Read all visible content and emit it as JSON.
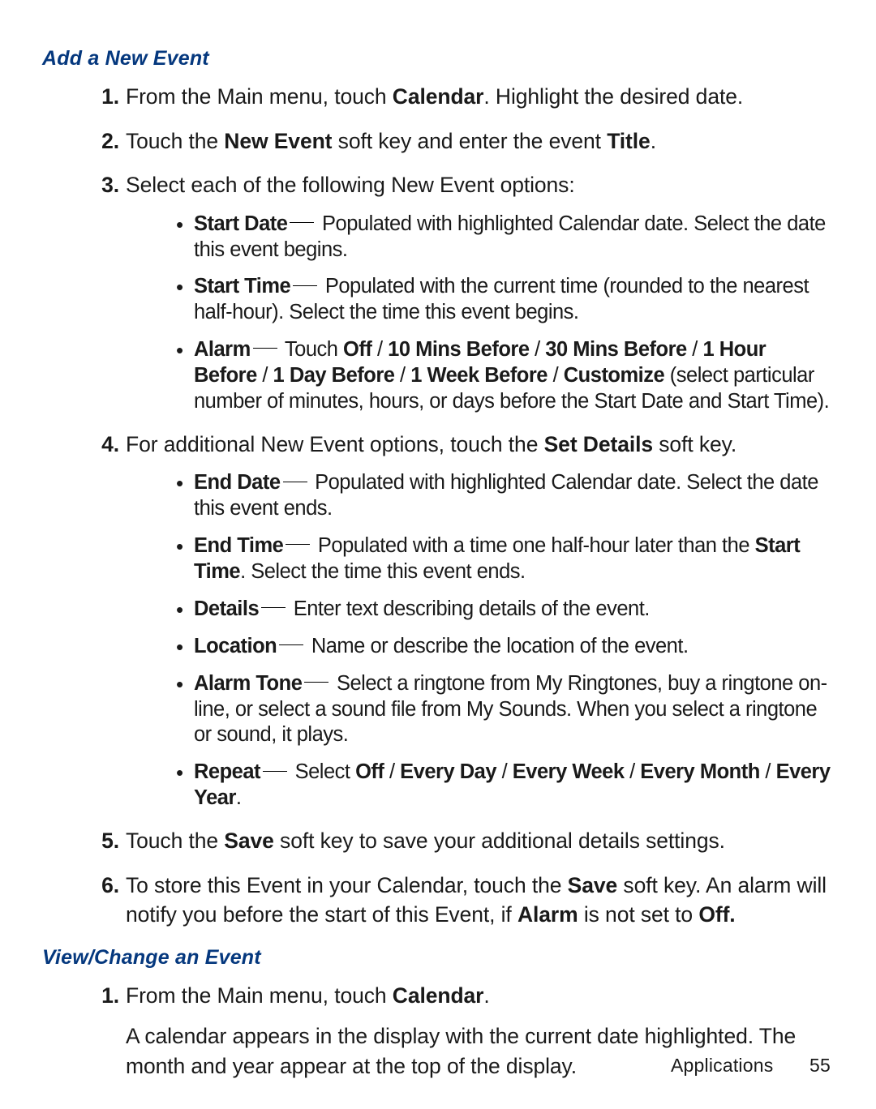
{
  "section1": {
    "title": "Add a New Event",
    "steps": [
      {
        "num": "1.",
        "runs": [
          {
            "t": "From the Main menu, touch "
          },
          {
            "t": "Calendar",
            "b": true
          },
          {
            "t": ". Highlight the desired date."
          }
        ]
      },
      {
        "num": "2.",
        "runs": [
          {
            "t": "Touch the "
          },
          {
            "t": "New Event",
            "b": true
          },
          {
            "t": " soft key and enter the event "
          },
          {
            "t": "Title",
            "b": true
          },
          {
            "t": "."
          }
        ]
      },
      {
        "num": "3.",
        "runs": [
          {
            "t": "Select each of the following New Event options:"
          }
        ],
        "bullets": [
          [
            {
              "t": "Start Date",
              "b": true
            },
            {
              "t": " ",
              "dash": true
            },
            {
              "t": " Populated with highlighted Calendar date. Select the date this event begins."
            }
          ],
          [
            {
              "t": "Start Time",
              "b": true
            },
            {
              "t": " ",
              "dash": true
            },
            {
              "t": " Populated with the current time (rounded to the nearest half-hour). Select the time this event begins."
            }
          ],
          [
            {
              "t": "Alarm",
              "b": true
            },
            {
              "t": " ",
              "dash": true
            },
            {
              "t": " Touch "
            },
            {
              "t": "Off",
              "b": true
            },
            {
              "t": " / "
            },
            {
              "t": "10 Mins Before",
              "b": true
            },
            {
              "t": " / "
            },
            {
              "t": "30 Mins Before",
              "b": true
            },
            {
              "t": " / "
            },
            {
              "t": "1 Hour Before",
              "b": true
            },
            {
              "t": " / "
            },
            {
              "t": "1 Day Before",
              "b": true
            },
            {
              "t": " / "
            },
            {
              "t": "1 Week Before",
              "b": true
            },
            {
              "t": " / "
            },
            {
              "t": "Customize",
              "b": true
            },
            {
              "t": " (select particular number of minutes, hours, or days before the Start Date and Start Time)."
            }
          ]
        ]
      },
      {
        "num": "4.",
        "runs": [
          {
            "t": "For additional New Event options, touch the "
          },
          {
            "t": "Set Details",
            "b": true
          },
          {
            "t": " soft key."
          }
        ],
        "bullets": [
          [
            {
              "t": "End Date",
              "b": true
            },
            {
              "t": " ",
              "dash": true
            },
            {
              "t": " Populated with highlighted Calendar date. Select the date this event ends."
            }
          ],
          [
            {
              "t": "End Time",
              "b": true
            },
            {
              "t": " ",
              "dash": true
            },
            {
              "t": " Populated with a time one half-hour later than the "
            },
            {
              "t": "Start Time",
              "b": true
            },
            {
              "t": ". Select the time this event ends."
            }
          ],
          [
            {
              "t": "Details",
              "b": true
            },
            {
              "t": " ",
              "dash": true
            },
            {
              "t": " Enter text describing details of the event."
            }
          ],
          [
            {
              "t": "Location",
              "b": true
            },
            {
              "t": " ",
              "dash": true
            },
            {
              "t": " Name or describe the location of the event."
            }
          ],
          [
            {
              "t": "Alarm Tone",
              "b": true
            },
            {
              "t": " ",
              "dash": true
            },
            {
              "t": " Select a ringtone from My Ringtones, buy a ringtone on-line, or select a sound file from My Sounds. When you select a ringtone or sound, it plays."
            }
          ],
          [
            {
              "t": "Repeat",
              "b": true
            },
            {
              "t": " ",
              "dash": true
            },
            {
              "t": " Select "
            },
            {
              "t": "Off",
              "b": true
            },
            {
              "t": " / "
            },
            {
              "t": "Every Day",
              "b": true
            },
            {
              "t": " / "
            },
            {
              "t": "Every Week",
              "b": true
            },
            {
              "t": " / "
            },
            {
              "t": "Every Month",
              "b": true
            },
            {
              "t": " / "
            },
            {
              "t": "Every Year",
              "b": true
            },
            {
              "t": "."
            }
          ]
        ]
      },
      {
        "num": "5.",
        "runs": [
          {
            "t": "Touch the "
          },
          {
            "t": "Save",
            "b": true
          },
          {
            "t": " soft key to save your additional details settings."
          }
        ]
      },
      {
        "num": "6.",
        "runs": [
          {
            "t": "To store this Event in your Calendar, touch the "
          },
          {
            "t": "Save",
            "b": true
          },
          {
            "t": " soft key. An alarm will notify you before the start of this Event, if "
          },
          {
            "t": "Alarm",
            "b": true
          },
          {
            "t": " is not set to "
          },
          {
            "t": "Off.",
            "b": true
          }
        ]
      }
    ]
  },
  "section2": {
    "title": "View/Change an Event",
    "steps": [
      {
        "num": "1.",
        "runs": [
          {
            "t": "From the Main menu, touch "
          },
          {
            "t": "Calendar",
            "b": true
          },
          {
            "t": "."
          }
        ],
        "para": [
          {
            "t": "A calendar appears in the display with the current date highlighted. The month and year appear at the top of the display."
          }
        ]
      }
    ]
  },
  "footer": {
    "text": "Applications",
    "page": "55"
  }
}
